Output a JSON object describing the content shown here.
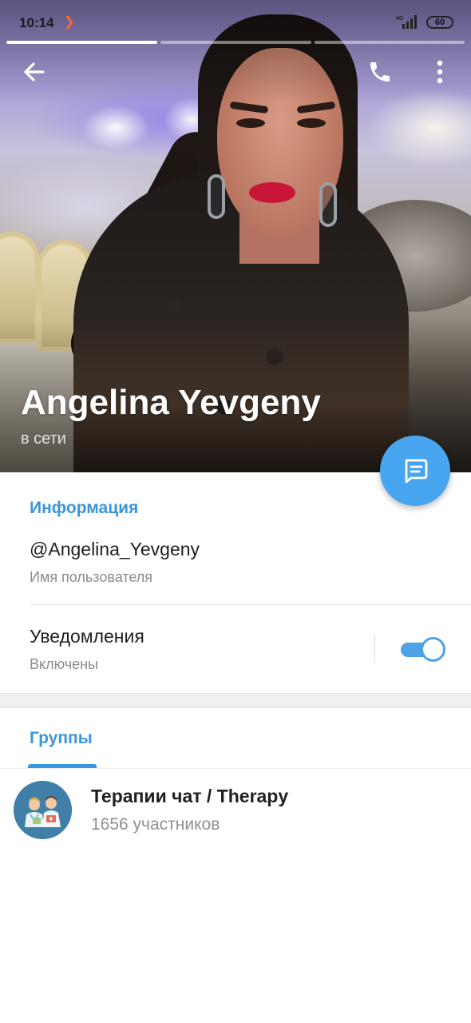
{
  "status_bar": {
    "time": "10:14",
    "network_label": "4G",
    "battery_level": "60"
  },
  "story_progress": {
    "segments": 3,
    "active_segment": 1
  },
  "toolbar": {
    "back_icon": "arrow-left-icon",
    "call_icon": "phone-icon",
    "menu_icon": "more-vertical-icon"
  },
  "profile": {
    "name": "Angelina Yevgeny",
    "status": "в сети"
  },
  "fab": {
    "icon": "message-icon",
    "color": "#48a5ef"
  },
  "info": {
    "section_title": "Информация",
    "username": "@Angelina_Yevgeny",
    "username_label": "Имя пользователя",
    "notifications_title": "Уведомления",
    "notifications_state": "Включены",
    "notifications_enabled": true
  },
  "tabs": [
    {
      "label": "Группы",
      "active": true
    }
  ],
  "groups": [
    {
      "name": "Терапии чат / Therapy",
      "members": "1656 участников",
      "avatar_icon": "doctors-icon"
    }
  ],
  "colors": {
    "accent": "#3a95dc",
    "toggle": "#4ea2e8"
  }
}
